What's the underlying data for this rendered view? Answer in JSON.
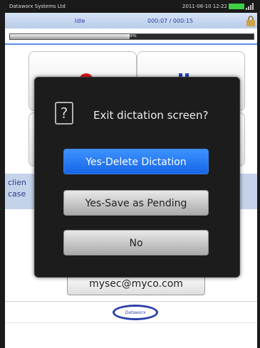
{
  "status_bar": {
    "carrier": "Dataworx Systems Ltd",
    "datetime": "2011-06-10  12:22"
  },
  "recorder": {
    "state": "Idle",
    "time": "000:07 / 000:15",
    "progress_percent": 49,
    "progress_label": "49%"
  },
  "list_band": {
    "line1": "clien",
    "line2": "case"
  },
  "email": "mysec@myco.com",
  "logo_text": "Dataworx",
  "dialog": {
    "title": "Exit dictation screen?",
    "icon_glyph": "?",
    "buttons": [
      {
        "label": "Yes-Delete Dictation"
      },
      {
        "label": "Yes-Save as Pending"
      },
      {
        "label": "No"
      }
    ]
  },
  "colors": {
    "primary_button": "#1f74f0",
    "record": "#e21b1b",
    "pause": "#2447c4",
    "battery": "#3fd045"
  }
}
